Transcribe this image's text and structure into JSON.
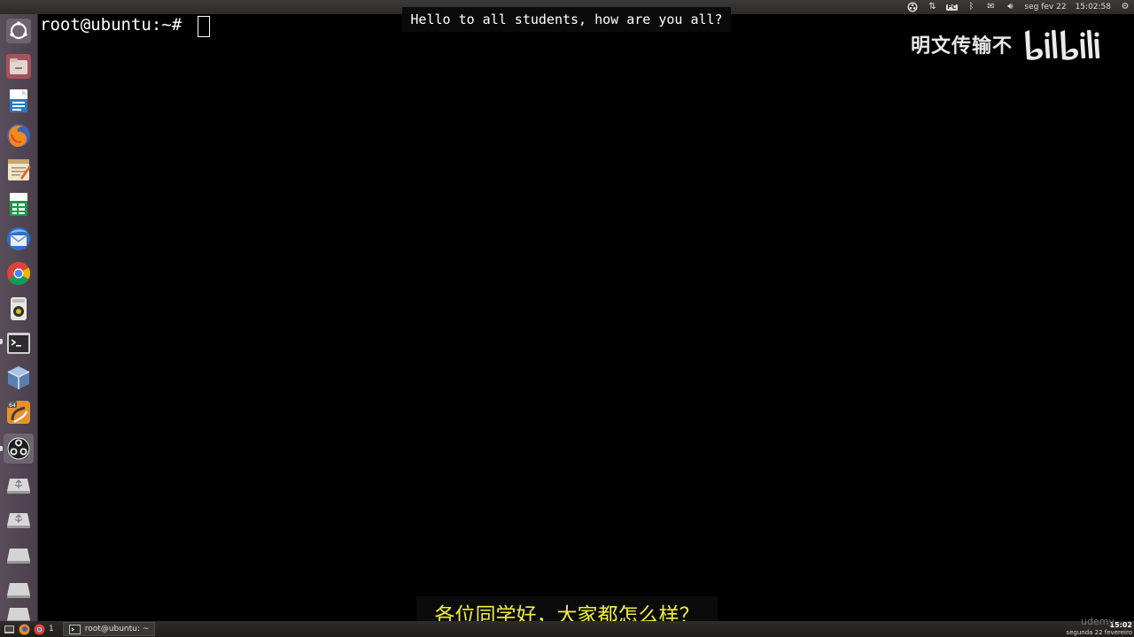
{
  "panel": {
    "keyboard_layout": "PC",
    "date": "seg fev 22",
    "time": "15:02:58"
  },
  "launcher": {
    "items": [
      {
        "name": "ubuntu-dash-icon"
      },
      {
        "name": "file-manager-icon"
      },
      {
        "name": "libreoffice-writer-icon"
      },
      {
        "name": "firefox-icon"
      },
      {
        "name": "text-editor-icon"
      },
      {
        "name": "libreoffice-calc-icon"
      },
      {
        "name": "thunderbird-icon"
      },
      {
        "name": "chrome-icon"
      },
      {
        "name": "media-player-icon"
      },
      {
        "name": "terminal-icon"
      },
      {
        "name": "virtualbox-icon"
      },
      {
        "name": "sublime-text-icon"
      },
      {
        "name": "obs-studio-icon"
      },
      {
        "name": "usb-drive-icon"
      },
      {
        "name": "usb-drive-icon-2"
      },
      {
        "name": "disk-drive-icon"
      },
      {
        "name": "disk-drive-icon-2"
      },
      {
        "name": "disk-drive-icon-3"
      }
    ]
  },
  "terminal": {
    "prompt": "root@ubuntu:~#"
  },
  "subtitles": {
    "english": "Hello to all students, how are you all?",
    "chinese": "各位同学好，大家都怎么样？"
  },
  "watermark": {
    "text": "明文传输不"
  },
  "taskbar": {
    "count": "1",
    "window_title": "root@ubuntu: ~",
    "clock_time": "15:02",
    "clock_date": "segunda 22 fevereiro",
    "udemy": "udemy"
  },
  "colors": {
    "subtitle_zh": "#f2ee3c",
    "terminal_bg": "#000000",
    "launcher_bg": "#54485a"
  }
}
